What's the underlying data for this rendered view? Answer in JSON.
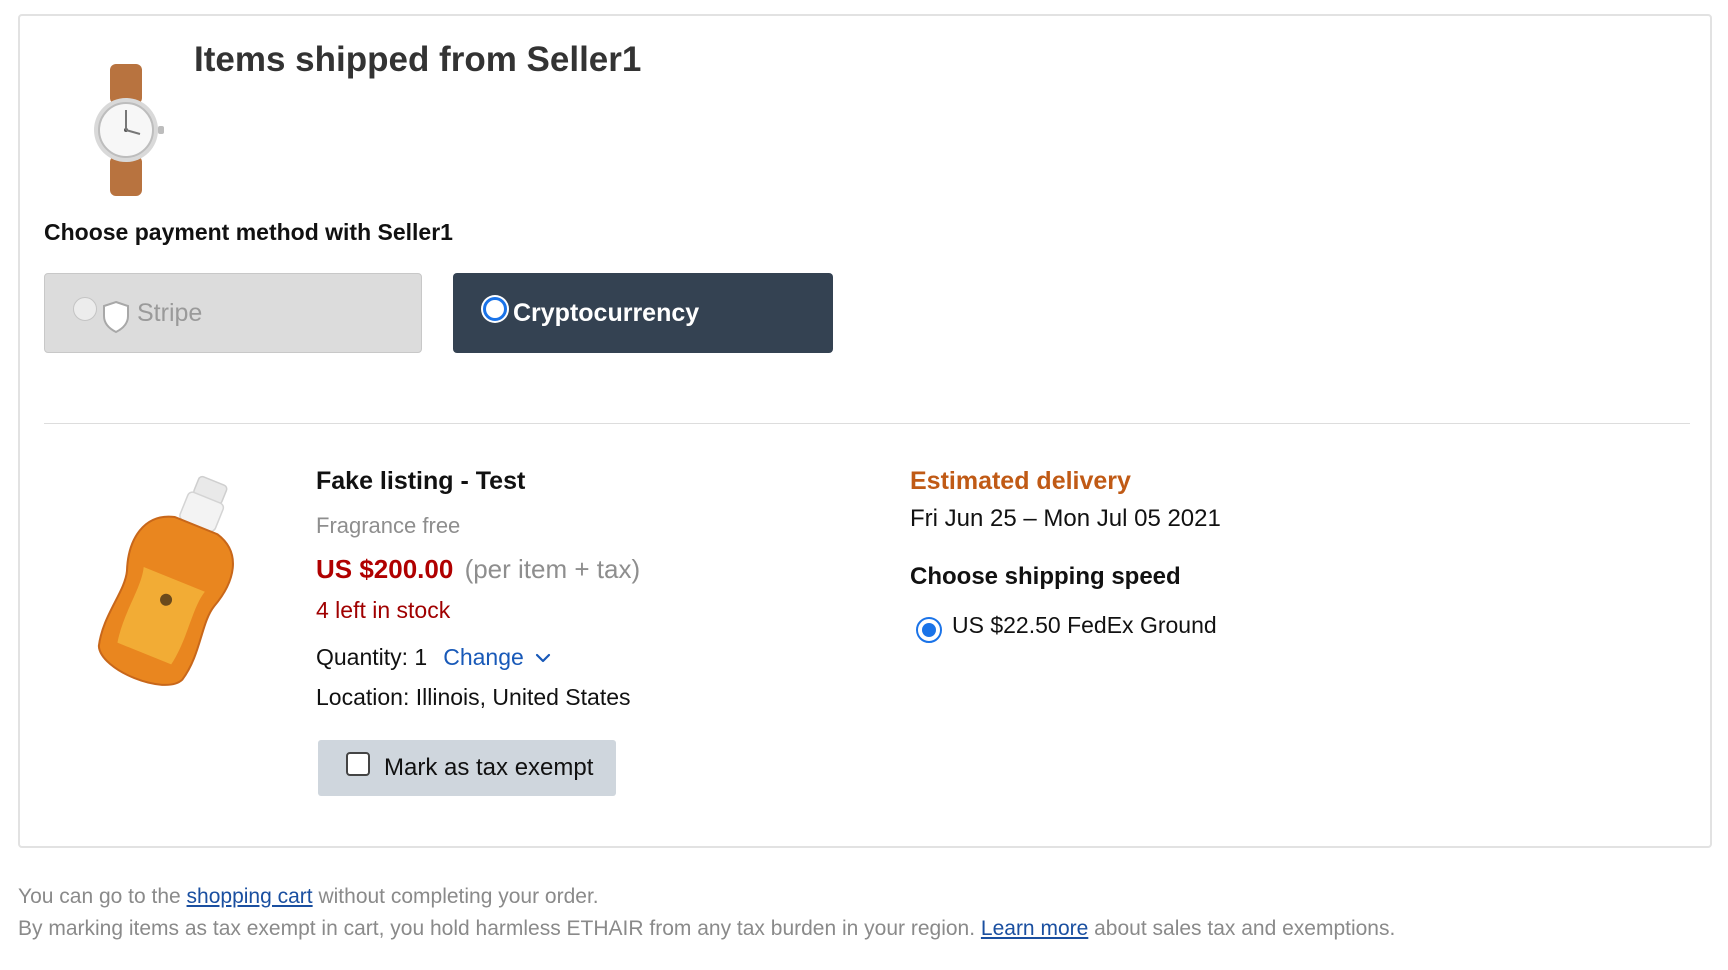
{
  "seller_section": {
    "title": "Items shipped from Seller1",
    "thumbnail_icon": "watch-image"
  },
  "payment": {
    "title": "Choose payment method with Seller1",
    "options": [
      {
        "label": "Stripe",
        "icon": "shield-icon",
        "state": "disabled",
        "selected": false
      },
      {
        "label": "Cryptocurrency",
        "state": "enabled",
        "selected": true
      }
    ]
  },
  "item": {
    "name": "Fake listing - Test",
    "variant": "Fragrance free",
    "price": "US $200.00",
    "price_note": "(per item + tax)",
    "stock": "4 left in stock",
    "quantity_label": "Quantity: 1",
    "change_label": "Change",
    "location": "Location: Illinois, United States",
    "tax_exempt_label": "Mark as tax exempt",
    "tax_exempt_checked": false
  },
  "delivery": {
    "title": "Estimated delivery",
    "dates": "Fri Jun 25 – Mon Jul 05 2021",
    "shipping_title": "Choose shipping speed",
    "shipping_option": "US $22.50 FedEx Ground",
    "shipping_selected": true
  },
  "footer": {
    "line1_prefix": "You can go to the ",
    "line1_link": "shopping cart",
    "line1_suffix": " without completing your order.",
    "line2_prefix": "By marking items as tax exempt in cart, you hold harmless ETHAIR from any tax burden in your region. ",
    "line2_link": "Learn more",
    "line2_suffix": " about sales tax and exemptions."
  },
  "colors": {
    "crypto_bg": "#344252",
    "price": "#b00000",
    "delivery_title": "#c05a15",
    "link": "#1859b8"
  }
}
